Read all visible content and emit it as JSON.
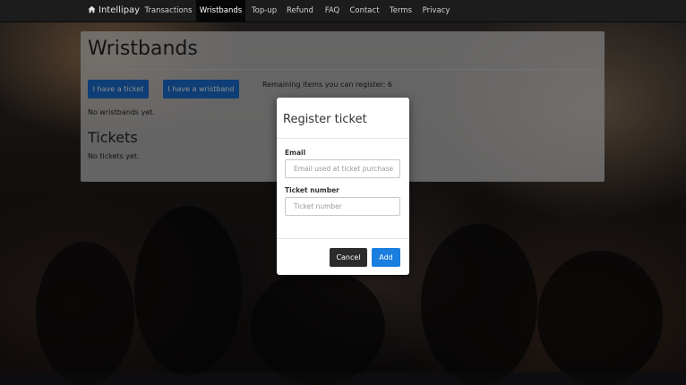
{
  "navbar": {
    "brand": "Intellipay",
    "brand_icon": "home-icon",
    "items": [
      {
        "label": "Transactions",
        "active": false
      },
      {
        "label": "Wristbands",
        "active": true
      },
      {
        "label": "Top-up",
        "active": false
      },
      {
        "label": "Refund",
        "active": false
      },
      {
        "label": "FAQ",
        "active": false
      },
      {
        "label": "Contact",
        "active": false
      },
      {
        "label": "Terms",
        "active": false
      },
      {
        "label": "Privacy",
        "active": false
      }
    ]
  },
  "page": {
    "title": "Wristbands",
    "have_ticket_button": "I have a ticket",
    "have_wristband_button": "I have a wristband",
    "remaining_text": "Remaining items you can register: 6",
    "no_wristbands": "No wristbands yet.",
    "tickets_title": "Tickets",
    "no_tickets": "No tickets yet."
  },
  "modal": {
    "title": "Register ticket",
    "email_label": "Email",
    "email_placeholder": "Email used at ticket purchase",
    "email_value": "",
    "ticket_label": "Ticket number",
    "ticket_placeholder": "Ticket number",
    "ticket_value": "",
    "cancel_label": "Cancel",
    "add_label": "Add"
  },
  "colors": {
    "primary": "#1a72d6",
    "navbar": "#1c1c1c",
    "cancel": "#2b2b2b"
  }
}
